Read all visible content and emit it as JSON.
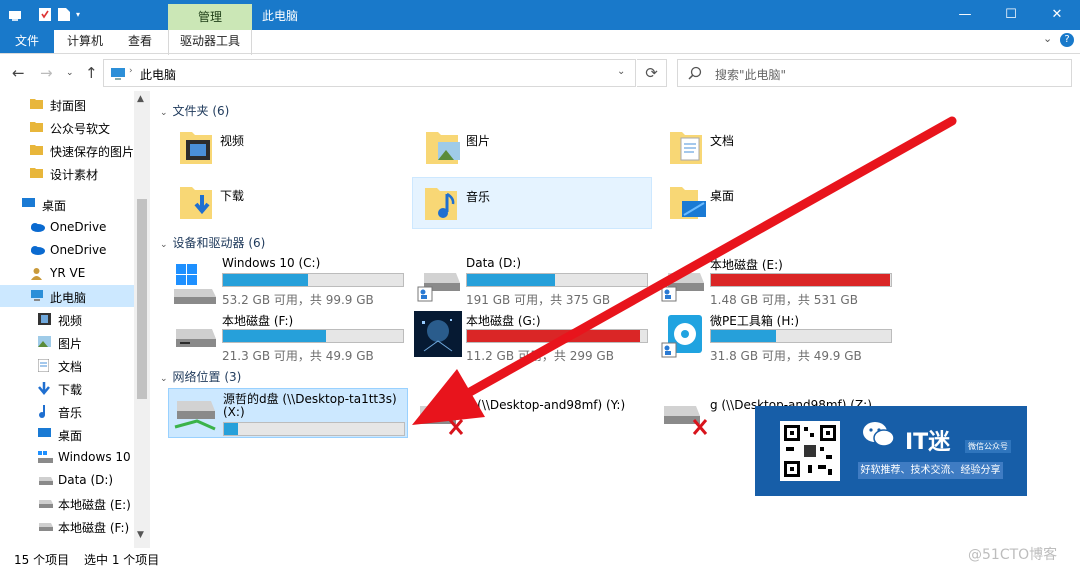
{
  "window": {
    "title": "此电脑",
    "context_tab": "管理",
    "controls": [
      "—",
      "☐",
      "✕"
    ]
  },
  "ribbon": {
    "tabs": [
      "文件",
      "计算机",
      "查看",
      "驱动器工具"
    ]
  },
  "nav": {
    "address": "此电脑",
    "search_placeholder": "搜索\"此电脑\""
  },
  "sidebar": {
    "items": [
      {
        "label": "封面图",
        "icon": "folder-icon"
      },
      {
        "label": "公众号软文",
        "icon": "folder-icon"
      },
      {
        "label": "快速保存的图片",
        "icon": "folder-icon"
      },
      {
        "label": "设计素材",
        "icon": "folder-icon"
      },
      {
        "label": "桌面",
        "icon": "desktop-icon"
      },
      {
        "label": "OneDrive",
        "icon": "onedrive-icon"
      },
      {
        "label": "OneDrive",
        "icon": "onedrive-icon"
      },
      {
        "label": "YR VE",
        "icon": "user-icon"
      },
      {
        "label": "此电脑",
        "icon": "computer-icon"
      },
      {
        "label": "视频",
        "icon": "video-icon"
      },
      {
        "label": "图片",
        "icon": "pictures-icon"
      },
      {
        "label": "文档",
        "icon": "documents-icon"
      },
      {
        "label": "下载",
        "icon": "download-icon"
      },
      {
        "label": "音乐",
        "icon": "music-icon"
      },
      {
        "label": "桌面",
        "icon": "desktop-icon"
      },
      {
        "label": "Windows 10 (",
        "icon": "windows-drive-icon"
      },
      {
        "label": "Data (D:)",
        "icon": "drive-icon"
      },
      {
        "label": "本地磁盘 (E:)",
        "icon": "drive-icon"
      },
      {
        "label": "本地磁盘 (F:)",
        "icon": "drive-icon"
      }
    ]
  },
  "sections": {
    "folders": "文件夹 (6)",
    "devices": "设备和驱动器 (6)",
    "network": "网络位置 (3)"
  },
  "folders": [
    {
      "label": "视频"
    },
    {
      "label": "图片"
    },
    {
      "label": "文档"
    },
    {
      "label": "下载"
    },
    {
      "label": "音乐"
    },
    {
      "label": "桌面"
    }
  ],
  "drives": [
    {
      "name": "Windows 10 (C:)",
      "info": "53.2 GB 可用，共 99.9 GB",
      "used_fraction": 0.47,
      "color": "#26a0da"
    },
    {
      "name": "Data (D:)",
      "info": "191 GB 可用，共 375 GB",
      "used_fraction": 0.49,
      "color": "#26a0da"
    },
    {
      "name": "本地磁盘 (E:)",
      "info": "1.48 GB 可用，共 531 GB",
      "used_fraction": 0.997,
      "color": "#da2626"
    },
    {
      "name": "本地磁盘 (F:)",
      "info": "21.3 GB 可用，共 49.9 GB",
      "used_fraction": 0.57,
      "color": "#26a0da"
    },
    {
      "name": "本地磁盘 (G:)",
      "info": "11.2 GB 可用，共 299 GB",
      "used_fraction": 0.96,
      "color": "#da2626"
    },
    {
      "name": "微PE工具箱 (H:)",
      "info": "31.8 GB 可用，共 49.9 GB",
      "used_fraction": 0.36,
      "color": "#26a0da"
    }
  ],
  "network": [
    {
      "name": "源哲的d盘 (\\\\Desktop-ta1tt3s)",
      "name2": "(X:)",
      "used_fraction": 0.08,
      "color": "#26a0da"
    },
    {
      "name": "a (\\\\Desktop-and98mf) (Y:)"
    },
    {
      "name": "g (\\\\Desktop-and98mf) (Z:)"
    }
  ],
  "status": {
    "count": "15 个项目",
    "selected": "选中 1 个项目"
  },
  "promo": {
    "title": "IT迷",
    "tag": "微信公众号",
    "slogan": "好软推荐、技术交流、经验分享"
  },
  "watermark": "@51CTO博客",
  "colors": {
    "titlebar": "#1979ca",
    "context_tab": "#cbe7b6",
    "selection": "#cce8ff",
    "arrow": "#e8141c"
  }
}
